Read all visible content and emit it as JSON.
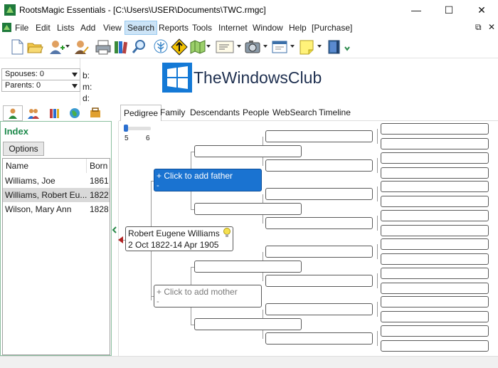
{
  "window": {
    "title": "RootsMagic Essentials - [C:\\Users\\USER\\Documents\\TWC.rmgc]",
    "minimize": "—",
    "maximize": "☐",
    "close": "✕",
    "mdi_restore": "⧉",
    "mdi_close": "✕"
  },
  "menu": [
    "File",
    "Edit",
    "Lists",
    "Add",
    "View",
    "Search",
    "Reports",
    "Tools",
    "Internet",
    "Window",
    "Help",
    "[Purchase]"
  ],
  "menu_active": "Search",
  "toolbar_icons": [
    "new-file-icon",
    "open-folder-icon",
    "add-person-icon",
    "edit-person-icon",
    "print-icon",
    "books-icon",
    "search-icon",
    "tree-icon",
    "arrow-up-icon",
    "map-icon",
    "certificate-icon",
    "media-icon",
    "window-icon",
    "note-icon",
    "help-book-icon"
  ],
  "family": {
    "spouses": "Spouses: 0",
    "parents": "Parents: 0",
    "b": "b:",
    "m": "m:",
    "d": "d:",
    "brand": "TheWindowsClub"
  },
  "index": {
    "title": "Index",
    "options": "Options",
    "col_name": "Name",
    "col_born": "Born",
    "rows": [
      {
        "name": "Williams, Joe",
        "born": "1861"
      },
      {
        "name": "Williams, Robert Eu...",
        "born": "1822"
      },
      {
        "name": "Wilson, Mary Ann",
        "born": "1828"
      }
    ],
    "selected_index": 1
  },
  "tabs": [
    "Pedigree",
    "Family",
    "Descendants",
    "People",
    "WebSearch",
    "Timeline"
  ],
  "active_tab": "Pedigree",
  "generations": {
    "min": "5",
    "max": "6",
    "value": 5
  },
  "pedigree": {
    "root_name": "Robert Eugene Williams",
    "root_dates": "2 Oct 1822-14 Apr 1905",
    "father_label": "+ Click to add father",
    "father_sub": "-",
    "mother_label": "+ Click to add mother",
    "mother_sub": "-"
  },
  "colors": {
    "accent": "#1a73d1",
    "index_green": "#1d8a4b",
    "selected_row": "#d9d9d9"
  }
}
